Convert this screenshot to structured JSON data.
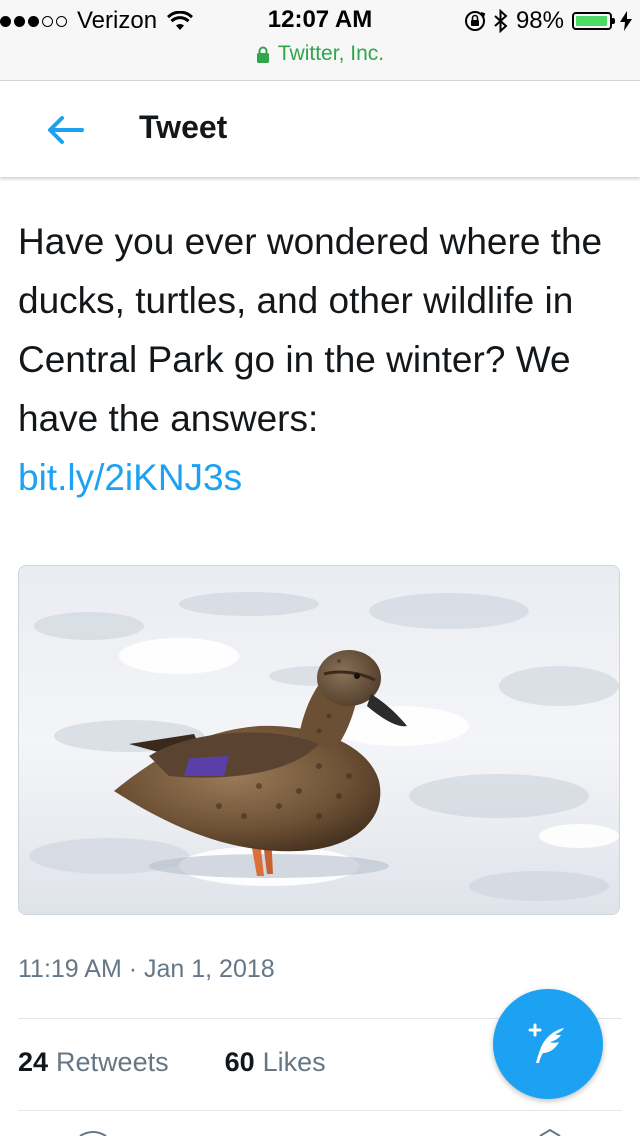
{
  "status_bar": {
    "carrier": "Verizon",
    "time": "12:07 AM",
    "battery": "98%",
    "battery_level": 0.98,
    "signal_bars_filled": 3,
    "signal_bars_total": 5,
    "icons": [
      "wifi-icon",
      "rotation-lock-icon",
      "bluetooth-icon",
      "battery-icon",
      "charging-bolt-icon"
    ]
  },
  "browser": {
    "url_label": "Twitter, Inc."
  },
  "header": {
    "title": "Tweet",
    "back_icon": "back-arrow-icon"
  },
  "tweet": {
    "text": "Have you ever wondered where the ducks, turtles, and other wildlife in Central Park go in the winter? We have the answers:",
    "link": "bit.ly/2iKNJ3s",
    "timestamp": "11:19 AM · Jan 1, 2018",
    "retweets_count": "24",
    "retweets_label": "Retweets",
    "likes_count": "60",
    "likes_label": "Likes"
  },
  "compose_button": {
    "icon": "compose-feather-icon"
  },
  "colors": {
    "accent": "#1da1f2",
    "text": "#14171a",
    "secondary_text": "#657786",
    "secure_green": "#30a64a"
  }
}
